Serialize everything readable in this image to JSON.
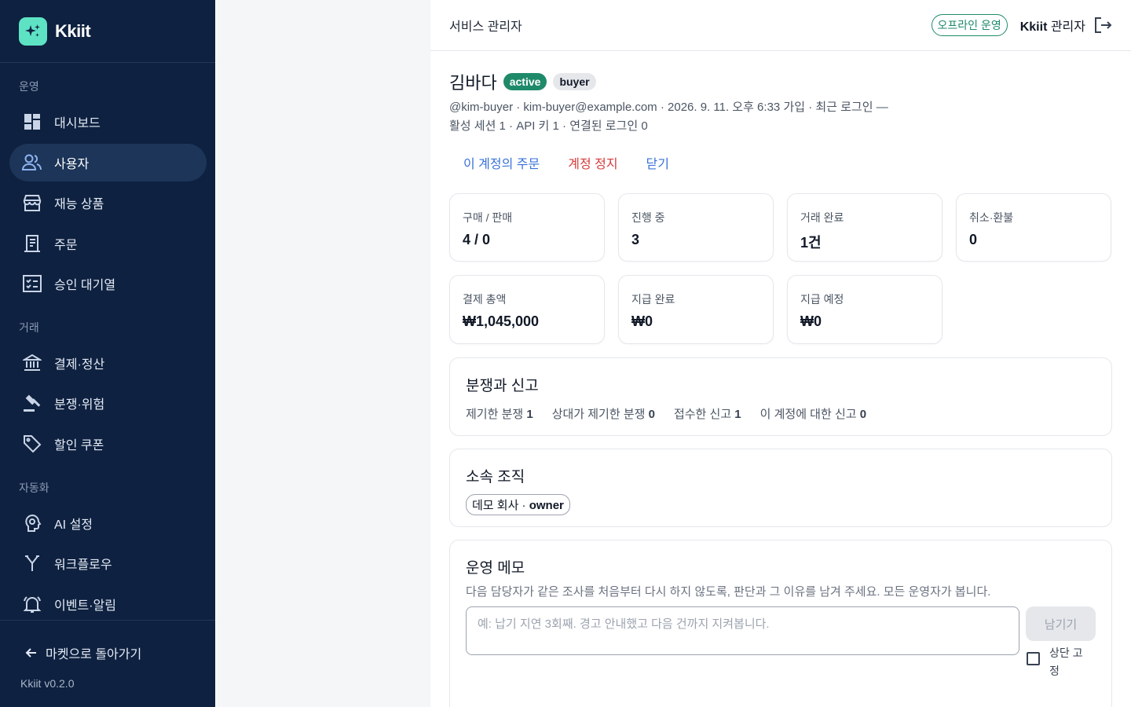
{
  "brand": {
    "name": "Kkiit"
  },
  "sidebar": {
    "sections": {
      "ops": "운영",
      "trade": "거래",
      "automation": "자동화"
    },
    "items": [
      {
        "label": "대시보드",
        "icon": "dashboard-icon"
      },
      {
        "label": "사용자",
        "icon": "users-icon",
        "active": true
      },
      {
        "label": "재능 상품",
        "icon": "store-icon"
      },
      {
        "label": "주문",
        "icon": "receipt-icon"
      },
      {
        "label": "승인 대기열",
        "icon": "approval-icon"
      },
      {
        "label": "결제·정산",
        "icon": "bank-icon"
      },
      {
        "label": "분쟁·위험",
        "icon": "gavel-icon"
      },
      {
        "label": "할인 쿠폰",
        "icon": "tag-icon"
      },
      {
        "label": "AI 설정",
        "icon": "ai-settings-icon"
      },
      {
        "label": "워크플로우",
        "icon": "workflow-icon"
      },
      {
        "label": "이벤트·알림",
        "icon": "bell-icon"
      }
    ],
    "back_label": "마켓으로 돌아가기",
    "version": "Kkiit v0.2.0"
  },
  "topbar": {
    "title": "서비스 관리자",
    "mode": "오프라인 운영",
    "admin_strong": "Kkiit",
    "admin_rest": " 관리자"
  },
  "user": {
    "name": "김바다",
    "status": "active",
    "role": "buyer",
    "meta_line1": "@kim-buyer · kim-buyer@example.com · 2026. 9. 11. 오후 6:33 가입 · 최근 로그인 —",
    "meta_line2": "활성 세션 1 · API 키 1 · 연결된 로그인 0"
  },
  "actions": {
    "orders": "이 계정의 주문",
    "suspend": "계정 정지",
    "close": "닫기"
  },
  "stats": [
    {
      "label": "구매 / 판매",
      "value": "4 / 0"
    },
    {
      "label": "진행 중",
      "value": "3"
    },
    {
      "label": "거래 완료",
      "value": "1건"
    },
    {
      "label": "취소·환불",
      "value": "0"
    },
    {
      "label": "결제 총액",
      "value": "₩1,045,000"
    },
    {
      "label": "지급 완료",
      "value": "₩0"
    },
    {
      "label": "지급 예정",
      "value": "₩0"
    }
  ],
  "disputes": {
    "title": "분쟁과 신고",
    "items": [
      {
        "label": "제기한 분쟁",
        "value": "1"
      },
      {
        "label": "상대가 제기한 분쟁",
        "value": "0"
      },
      {
        "label": "접수한 신고",
        "value": "1"
      },
      {
        "label": "이 계정에 대한 신고",
        "value": "0"
      }
    ]
  },
  "org": {
    "title": "소속 조직",
    "name": "데모 회사 · ",
    "role": "owner"
  },
  "memo": {
    "title": "운영 메모",
    "description": "다음 담당자가 같은 조사를 처음부터 다시 하지 않도록, 판단과 그 이유를 남겨 주세요. 모든 운영자가 봅니다.",
    "placeholder": "예: 납기 지연 3회째. 경고 안내했고 다음 건까지 지켜봅니다.",
    "submit": "남기기",
    "pin_label": "상단 고정"
  }
}
